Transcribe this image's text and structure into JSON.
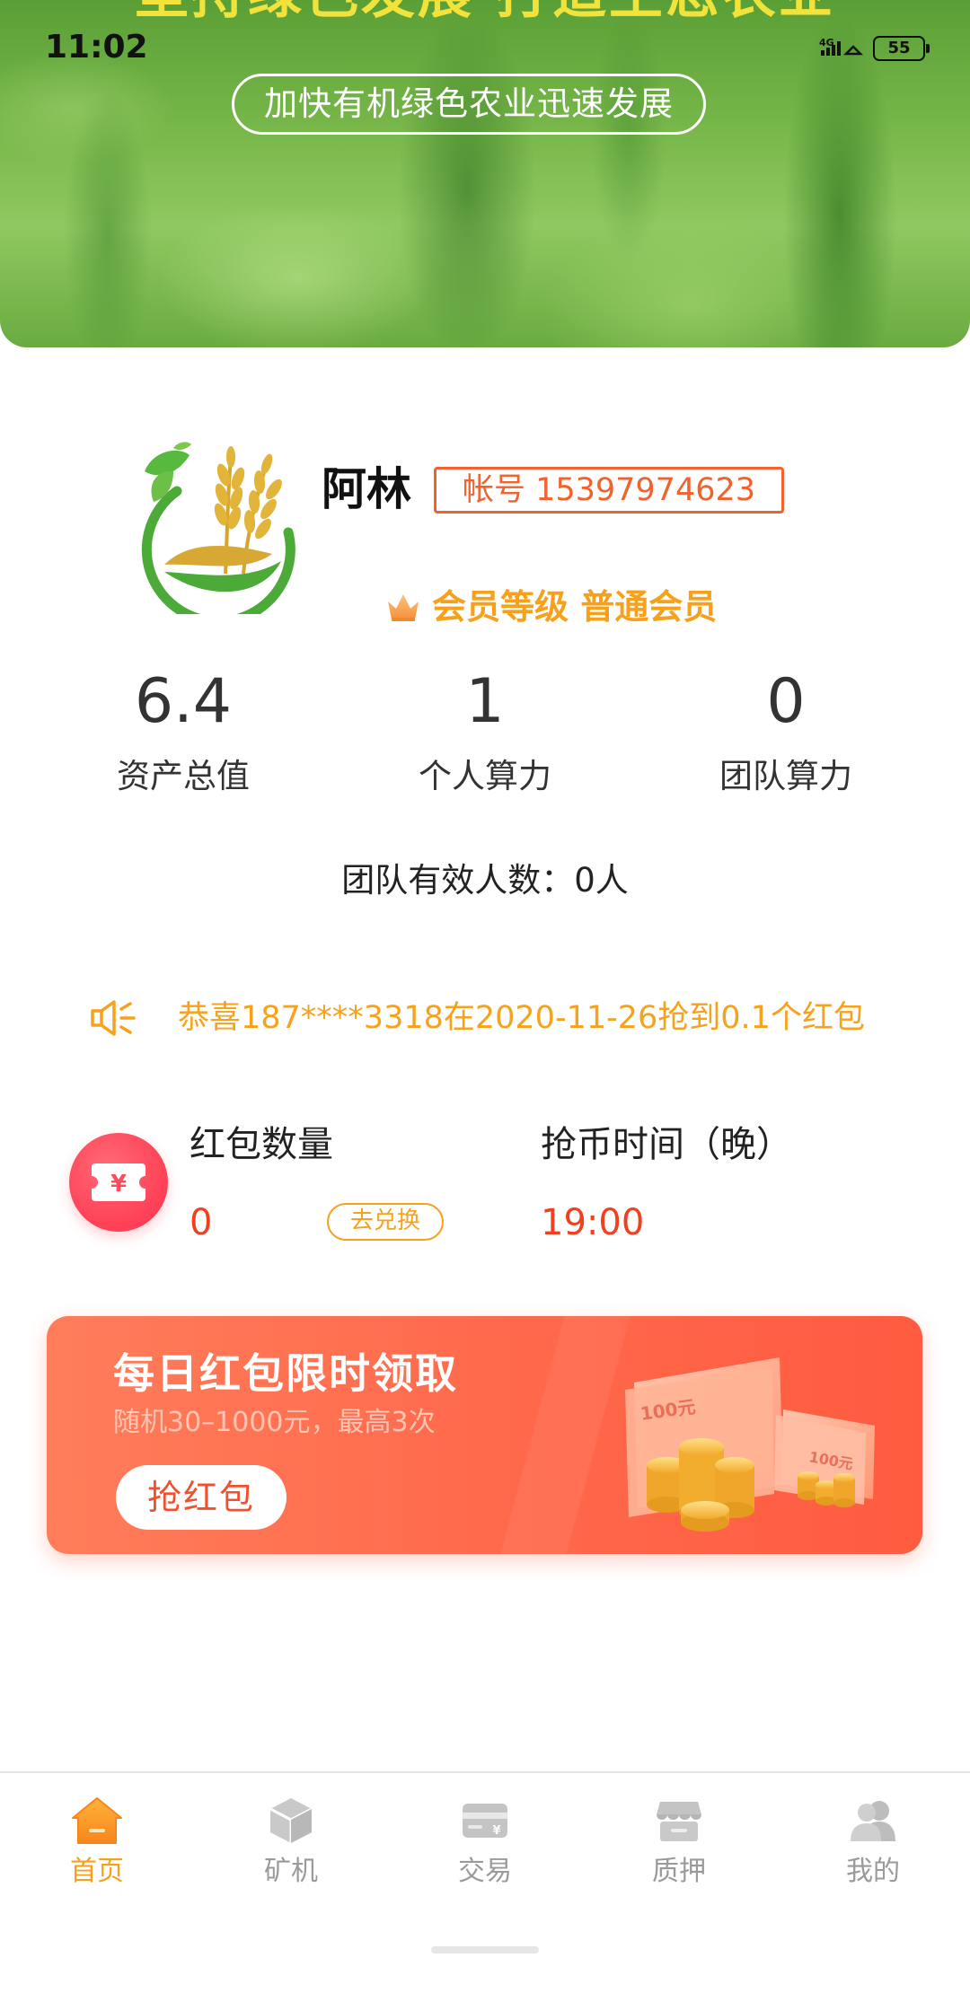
{
  "status_bar": {
    "time": "11:02",
    "network": "4G",
    "battery": "55"
  },
  "banner": {
    "title": "坚持绿色发展 打造生态农业",
    "slogan": "加快有机绿色农业迅速发展"
  },
  "profile": {
    "name": "阿林",
    "account_label": "帐号 15397974623",
    "member_level": "会员等级 普通会员",
    "logo_icon": "wheat-logo",
    "badge_icon": "crown-icon"
  },
  "stats": [
    {
      "value": "6.4",
      "label": "资产总值"
    },
    {
      "value": "1",
      "label": "个人算力"
    },
    {
      "value": "0",
      "label": "团队算力"
    }
  ],
  "team_count": "团队有效人数：0人",
  "notice": {
    "icon": "speaker-icon",
    "text": "恭喜187****3318在2020-11-26抢到0.1个红包"
  },
  "red_packet": {
    "icon": "red-packet-icon",
    "icon_symbol": "¥",
    "count_label": "红包数量",
    "count_value": "0",
    "exchange_button": "去兑换",
    "time_label": "抢币时间（晚）",
    "time_value": "19:00"
  },
  "promo": {
    "title": "每日红包限时领取",
    "subtitle": "随机30–1000元，最高3次",
    "button": "抢红包",
    "note_label": "100元"
  },
  "nav": {
    "items": [
      {
        "label": "首页",
        "icon": "home-icon",
        "active": true
      },
      {
        "label": "矿机",
        "icon": "cube-icon",
        "active": false
      },
      {
        "label": "交易",
        "icon": "card-icon",
        "active": false
      },
      {
        "label": "质押",
        "icon": "store-icon",
        "active": false
      },
      {
        "label": "我的",
        "icon": "user-icon",
        "active": false
      }
    ]
  },
  "colors": {
    "accent": "#f7a01b",
    "account": "#f0622e",
    "value_red": "#f0401f",
    "packet": "#ff4b5e",
    "nav_inactive": "#9a9a9a"
  }
}
